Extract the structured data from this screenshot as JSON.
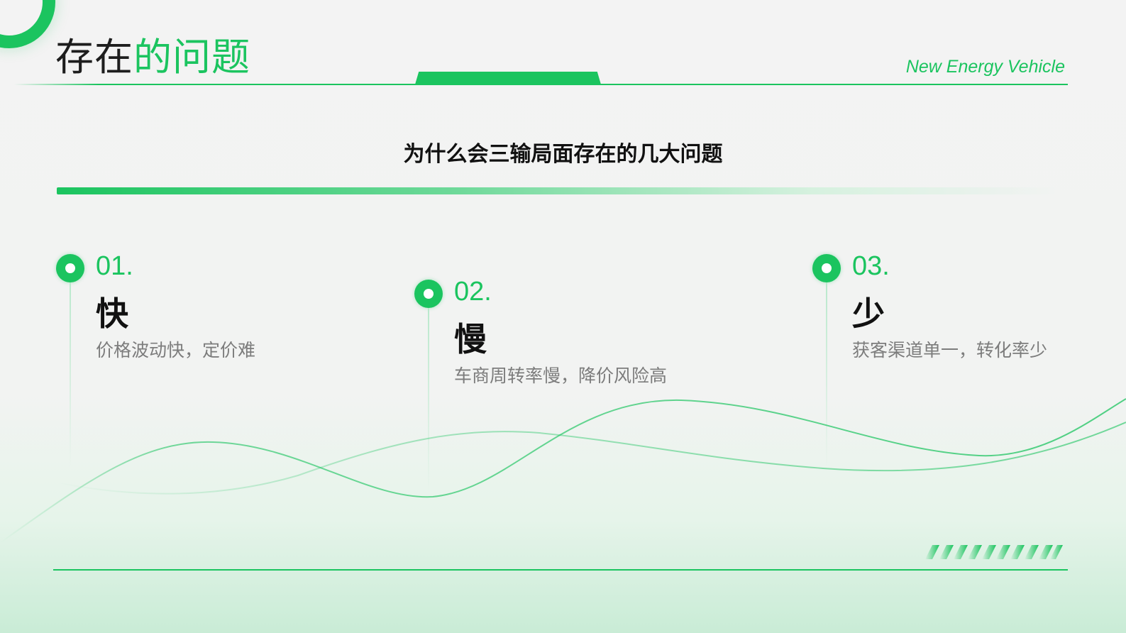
{
  "header": {
    "title_part1": "存在",
    "title_part2": "的问题",
    "brand_subtitle": "New Energy Vehicle"
  },
  "subtitle": "为什么会三输局面存在的几大问题",
  "points": [
    {
      "number": "01.",
      "heading": "快",
      "description": "价格波动快，定价难"
    },
    {
      "number": "02.",
      "heading": "慢",
      "description": "车商周转率慢，降价风险高"
    },
    {
      "number": "03.",
      "heading": "少",
      "description": "获客渠道单一，转化率少"
    }
  ],
  "colors": {
    "accent": "#1bc45f",
    "text": "#111111",
    "muted": "#7c7c7c"
  }
}
